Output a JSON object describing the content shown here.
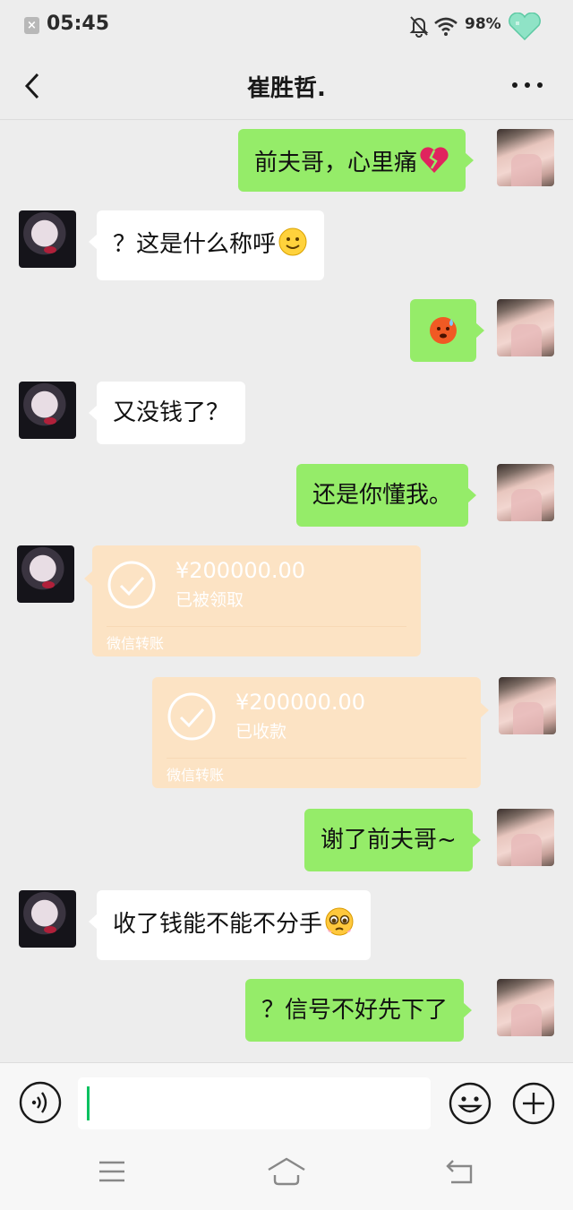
{
  "status_bar": {
    "time": "05:45",
    "battery": "98%",
    "notif_badge": "×"
  },
  "header": {
    "title": "崔胜哲."
  },
  "messages": [
    {
      "side": "right",
      "type": "text",
      "text": "前夫哥，心里痛",
      "emoji": "broken-heart"
    },
    {
      "side": "left",
      "type": "text",
      "text": "？这是什么称呼",
      "emoji": "smile"
    },
    {
      "side": "right",
      "type": "emoji",
      "emoji": "sweat-angry"
    },
    {
      "side": "left",
      "type": "text",
      "text": "又没钱了？"
    },
    {
      "side": "right",
      "type": "text",
      "text": "还是你懂我。"
    },
    {
      "side": "left",
      "type": "transfer",
      "amount": "¥200000.00",
      "status": "已被领取",
      "label": "微信转账"
    },
    {
      "side": "right",
      "type": "transfer",
      "amount": "¥200000.00",
      "status": "已收款",
      "label": "微信转账"
    },
    {
      "side": "right",
      "type": "text",
      "text": "谢了前夫哥~"
    },
    {
      "side": "left",
      "type": "text",
      "text": "收了钱能不能不分手",
      "emoji": "pleading"
    },
    {
      "side": "right",
      "type": "text",
      "text": "？信号不好先下了"
    }
  ],
  "input": {
    "value": ""
  },
  "colors": {
    "bg": "#ededed",
    "bubble_self": "#95ec69",
    "bubble_other": "#ffffff",
    "transfer": "#fce3c4",
    "accent": "#07c160"
  }
}
